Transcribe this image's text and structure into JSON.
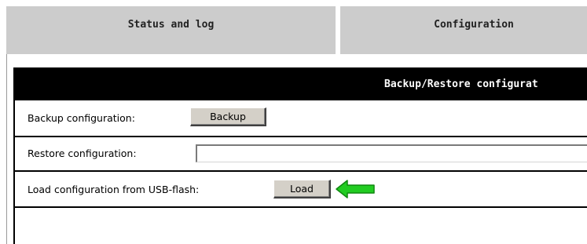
{
  "tabs": [
    {
      "label": "Status and log"
    },
    {
      "label": "Configuration"
    }
  ],
  "panel": {
    "title": "Backup/Restore configurat"
  },
  "rows": {
    "backup": {
      "label": "Backup configuration:",
      "button": "Backup"
    },
    "restore": {
      "label": "Restore configuration:",
      "input_value": ""
    },
    "load": {
      "label": "Load configuration from USB-flash:",
      "button": "Load"
    }
  },
  "icons": {
    "arrow": "left-arrow-icon"
  },
  "colors": {
    "tab_background": "#cccccc",
    "header_background": "#000000",
    "header_text": "#ffffff",
    "button_face": "#d4d0c8",
    "arrow_fill": "#22cc22",
    "arrow_stroke": "#118811"
  }
}
